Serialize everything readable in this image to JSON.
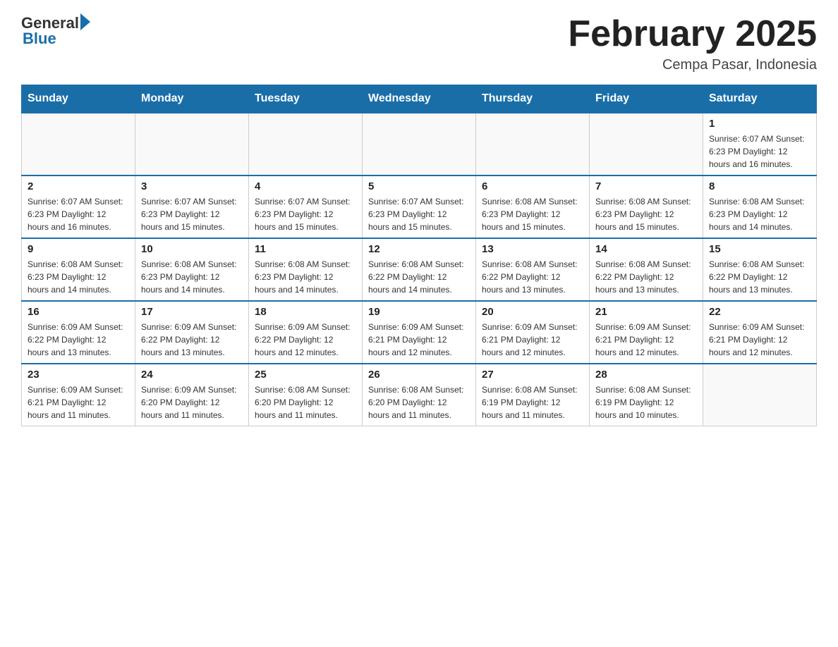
{
  "header": {
    "logo_general": "General",
    "logo_blue": "Blue",
    "month_title": "February 2025",
    "location": "Cempa Pasar, Indonesia"
  },
  "calendar": {
    "days_of_week": [
      "Sunday",
      "Monday",
      "Tuesday",
      "Wednesday",
      "Thursday",
      "Friday",
      "Saturday"
    ],
    "weeks": [
      [
        {
          "day": "",
          "info": ""
        },
        {
          "day": "",
          "info": ""
        },
        {
          "day": "",
          "info": ""
        },
        {
          "day": "",
          "info": ""
        },
        {
          "day": "",
          "info": ""
        },
        {
          "day": "",
          "info": ""
        },
        {
          "day": "1",
          "info": "Sunrise: 6:07 AM\nSunset: 6:23 PM\nDaylight: 12 hours and 16 minutes."
        }
      ],
      [
        {
          "day": "2",
          "info": "Sunrise: 6:07 AM\nSunset: 6:23 PM\nDaylight: 12 hours and 16 minutes."
        },
        {
          "day": "3",
          "info": "Sunrise: 6:07 AM\nSunset: 6:23 PM\nDaylight: 12 hours and 15 minutes."
        },
        {
          "day": "4",
          "info": "Sunrise: 6:07 AM\nSunset: 6:23 PM\nDaylight: 12 hours and 15 minutes."
        },
        {
          "day": "5",
          "info": "Sunrise: 6:07 AM\nSunset: 6:23 PM\nDaylight: 12 hours and 15 minutes."
        },
        {
          "day": "6",
          "info": "Sunrise: 6:08 AM\nSunset: 6:23 PM\nDaylight: 12 hours and 15 minutes."
        },
        {
          "day": "7",
          "info": "Sunrise: 6:08 AM\nSunset: 6:23 PM\nDaylight: 12 hours and 15 minutes."
        },
        {
          "day": "8",
          "info": "Sunrise: 6:08 AM\nSunset: 6:23 PM\nDaylight: 12 hours and 14 minutes."
        }
      ],
      [
        {
          "day": "9",
          "info": "Sunrise: 6:08 AM\nSunset: 6:23 PM\nDaylight: 12 hours and 14 minutes."
        },
        {
          "day": "10",
          "info": "Sunrise: 6:08 AM\nSunset: 6:23 PM\nDaylight: 12 hours and 14 minutes."
        },
        {
          "day": "11",
          "info": "Sunrise: 6:08 AM\nSunset: 6:23 PM\nDaylight: 12 hours and 14 minutes."
        },
        {
          "day": "12",
          "info": "Sunrise: 6:08 AM\nSunset: 6:22 PM\nDaylight: 12 hours and 14 minutes."
        },
        {
          "day": "13",
          "info": "Sunrise: 6:08 AM\nSunset: 6:22 PM\nDaylight: 12 hours and 13 minutes."
        },
        {
          "day": "14",
          "info": "Sunrise: 6:08 AM\nSunset: 6:22 PM\nDaylight: 12 hours and 13 minutes."
        },
        {
          "day": "15",
          "info": "Sunrise: 6:08 AM\nSunset: 6:22 PM\nDaylight: 12 hours and 13 minutes."
        }
      ],
      [
        {
          "day": "16",
          "info": "Sunrise: 6:09 AM\nSunset: 6:22 PM\nDaylight: 12 hours and 13 minutes."
        },
        {
          "day": "17",
          "info": "Sunrise: 6:09 AM\nSunset: 6:22 PM\nDaylight: 12 hours and 13 minutes."
        },
        {
          "day": "18",
          "info": "Sunrise: 6:09 AM\nSunset: 6:22 PM\nDaylight: 12 hours and 12 minutes."
        },
        {
          "day": "19",
          "info": "Sunrise: 6:09 AM\nSunset: 6:21 PM\nDaylight: 12 hours and 12 minutes."
        },
        {
          "day": "20",
          "info": "Sunrise: 6:09 AM\nSunset: 6:21 PM\nDaylight: 12 hours and 12 minutes."
        },
        {
          "day": "21",
          "info": "Sunrise: 6:09 AM\nSunset: 6:21 PM\nDaylight: 12 hours and 12 minutes."
        },
        {
          "day": "22",
          "info": "Sunrise: 6:09 AM\nSunset: 6:21 PM\nDaylight: 12 hours and 12 minutes."
        }
      ],
      [
        {
          "day": "23",
          "info": "Sunrise: 6:09 AM\nSunset: 6:21 PM\nDaylight: 12 hours and 11 minutes."
        },
        {
          "day": "24",
          "info": "Sunrise: 6:09 AM\nSunset: 6:20 PM\nDaylight: 12 hours and 11 minutes."
        },
        {
          "day": "25",
          "info": "Sunrise: 6:08 AM\nSunset: 6:20 PM\nDaylight: 12 hours and 11 minutes."
        },
        {
          "day": "26",
          "info": "Sunrise: 6:08 AM\nSunset: 6:20 PM\nDaylight: 12 hours and 11 minutes."
        },
        {
          "day": "27",
          "info": "Sunrise: 6:08 AM\nSunset: 6:19 PM\nDaylight: 12 hours and 11 minutes."
        },
        {
          "day": "28",
          "info": "Sunrise: 6:08 AM\nSunset: 6:19 PM\nDaylight: 12 hours and 10 minutes."
        },
        {
          "day": "",
          "info": ""
        }
      ]
    ]
  }
}
